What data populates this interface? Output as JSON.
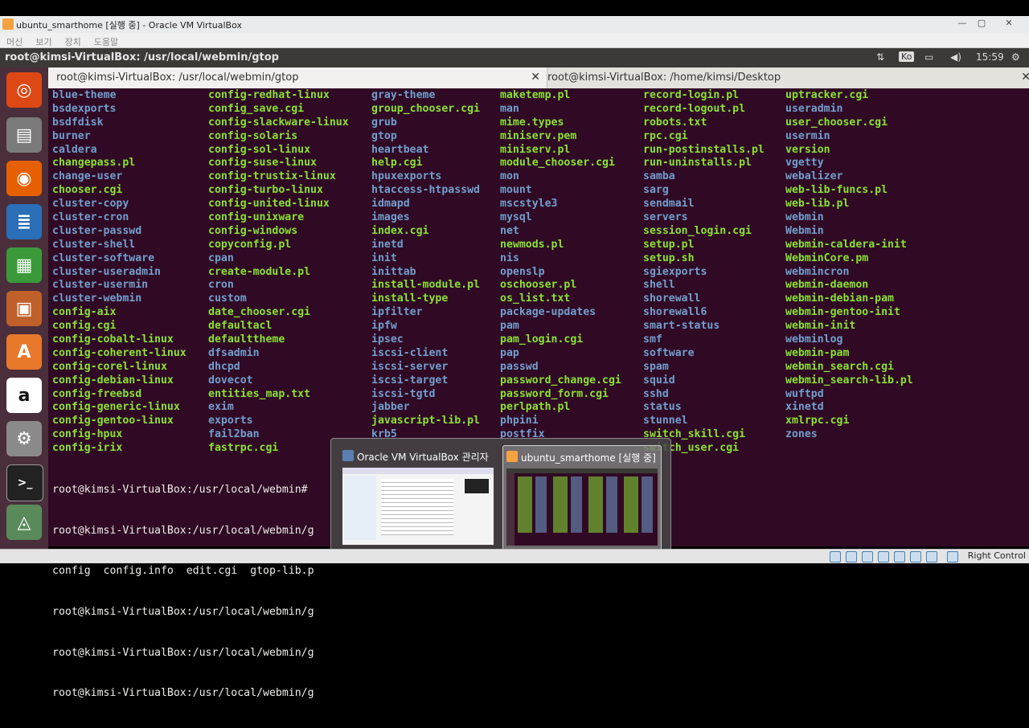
{
  "vbox": {
    "title": "ubuntu_smarthome [실행 중] - Oracle VM VirtualBox",
    "menu": [
      "머신",
      "보기",
      "장치",
      "도움말"
    ],
    "host_key": "Right Control"
  },
  "ubuntu_panel": {
    "title": "root@kimsi-VirtualBox: /usr/local/webmin/gtop",
    "keyboard": "Ko",
    "time": "15:59"
  },
  "terminal": {
    "tabs": [
      {
        "label": "root@kimsi-VirtualBox: /usr/local/webmin/gtop"
      },
      {
        "label": "root@kimsi-VirtualBox: /home/kimsi/Desktop"
      }
    ],
    "columns": [
      {
        "items": [
          {
            "t": "blue-theme",
            "c": "b"
          },
          {
            "t": "bsdexports",
            "c": "b"
          },
          {
            "t": "bsdfdisk",
            "c": "b"
          },
          {
            "t": "burner",
            "c": "b"
          },
          {
            "t": "caldera",
            "c": "b"
          },
          {
            "t": "changepass.pl",
            "c": "w"
          },
          {
            "t": "change-user",
            "c": "b"
          },
          {
            "t": "chooser.cgi",
            "c": "w"
          },
          {
            "t": "cluster-copy",
            "c": "b"
          },
          {
            "t": "cluster-cron",
            "c": "b"
          },
          {
            "t": "cluster-passwd",
            "c": "b"
          },
          {
            "t": "cluster-shell",
            "c": "b"
          },
          {
            "t": "cluster-software",
            "c": "b"
          },
          {
            "t": "cluster-useradmin",
            "c": "b"
          },
          {
            "t": "cluster-usermin",
            "c": "b"
          },
          {
            "t": "cluster-webmin",
            "c": "b"
          },
          {
            "t": "config-aix",
            "c": "w"
          },
          {
            "t": "config.cgi",
            "c": "w"
          },
          {
            "t": "config-cobalt-linux",
            "c": "w"
          },
          {
            "t": "config-coherent-linux",
            "c": "w"
          },
          {
            "t": "config-corel-linux",
            "c": "w"
          },
          {
            "t": "config-debian-linux",
            "c": "w"
          },
          {
            "t": "config-freebsd",
            "c": "w"
          },
          {
            "t": "config-generic-linux",
            "c": "w"
          },
          {
            "t": "config-gentoo-linux",
            "c": "w"
          },
          {
            "t": "config-hpux",
            "c": "w"
          },
          {
            "t": "config-irix",
            "c": "w"
          }
        ]
      },
      {
        "items": [
          {
            "t": "config-redhat-linux",
            "c": "w"
          },
          {
            "t": "config_save.cgi",
            "c": "w"
          },
          {
            "t": "config-slackware-linux",
            "c": "w"
          },
          {
            "t": "config-solaris",
            "c": "w"
          },
          {
            "t": "config-sol-linux",
            "c": "w"
          },
          {
            "t": "config-suse-linux",
            "c": "w"
          },
          {
            "t": "config-trustix-linux",
            "c": "w"
          },
          {
            "t": "config-turbo-linux",
            "c": "w"
          },
          {
            "t": "config-united-linux",
            "c": "w"
          },
          {
            "t": "config-unixware",
            "c": "w"
          },
          {
            "t": "config-windows",
            "c": "w"
          },
          {
            "t": "copyconfig.pl",
            "c": "w"
          },
          {
            "t": "cpan",
            "c": "b"
          },
          {
            "t": "create-module.pl",
            "c": "w"
          },
          {
            "t": "cron",
            "c": "b"
          },
          {
            "t": "custom",
            "c": "b"
          },
          {
            "t": "date_chooser.cgi",
            "c": "w"
          },
          {
            "t": "defaultacl",
            "c": "w"
          },
          {
            "t": "defaulttheme",
            "c": "w"
          },
          {
            "t": "dfsadmin",
            "c": "b"
          },
          {
            "t": "dhcpd",
            "c": "b"
          },
          {
            "t": "dovecot",
            "c": "b"
          },
          {
            "t": "entities_map.txt",
            "c": "w"
          },
          {
            "t": "exim",
            "c": "b"
          },
          {
            "t": "exports",
            "c": "b"
          },
          {
            "t": "fail2ban",
            "c": "b"
          },
          {
            "t": "fastrpc.cgi",
            "c": "w"
          }
        ]
      },
      {
        "items": [
          {
            "t": "gray-theme",
            "c": "b"
          },
          {
            "t": "group_chooser.cgi",
            "c": "w"
          },
          {
            "t": "grub",
            "c": "b"
          },
          {
            "t": "gtop",
            "c": "b"
          },
          {
            "t": "heartbeat",
            "c": "b"
          },
          {
            "t": "help.cgi",
            "c": "w"
          },
          {
            "t": "hpuxexports",
            "c": "b"
          },
          {
            "t": "htaccess-htpasswd",
            "c": "b"
          },
          {
            "t": "idmapd",
            "c": "b"
          },
          {
            "t": "images",
            "c": "b"
          },
          {
            "t": "index.cgi",
            "c": "w"
          },
          {
            "t": "inetd",
            "c": "b"
          },
          {
            "t": "init",
            "c": "b"
          },
          {
            "t": "inittab",
            "c": "b"
          },
          {
            "t": "install-module.pl",
            "c": "w"
          },
          {
            "t": "install-type",
            "c": "w"
          },
          {
            "t": "ipfilter",
            "c": "b"
          },
          {
            "t": "ipfw",
            "c": "b"
          },
          {
            "t": "ipsec",
            "c": "b"
          },
          {
            "t": "iscsi-client",
            "c": "b"
          },
          {
            "t": "iscsi-server",
            "c": "b"
          },
          {
            "t": "iscsi-target",
            "c": "b"
          },
          {
            "t": "iscsi-tgtd",
            "c": "b"
          },
          {
            "t": "jabber",
            "c": "b"
          },
          {
            "t": "javascript-lib.pl",
            "c": "w"
          },
          {
            "t": "krb5",
            "c": "b"
          }
        ]
      },
      {
        "items": [
          {
            "t": "maketemp.pl",
            "c": "w"
          },
          {
            "t": "man",
            "c": "b"
          },
          {
            "t": "mime.types",
            "c": "w"
          },
          {
            "t": "miniserv.pem",
            "c": "w"
          },
          {
            "t": "miniserv.pl",
            "c": "w"
          },
          {
            "t": "module_chooser.cgi",
            "c": "w"
          },
          {
            "t": "mon",
            "c": "b"
          },
          {
            "t": "mount",
            "c": "b"
          },
          {
            "t": "mscstyle3",
            "c": "b"
          },
          {
            "t": "mysql",
            "c": "b"
          },
          {
            "t": "net",
            "c": "b"
          },
          {
            "t": "newmods.pl",
            "c": "w"
          },
          {
            "t": "nis",
            "c": "b"
          },
          {
            "t": "openslp",
            "c": "b"
          },
          {
            "t": "oschooser.pl",
            "c": "w"
          },
          {
            "t": "os_list.txt",
            "c": "w"
          },
          {
            "t": "package-updates",
            "c": "b"
          },
          {
            "t": "pam",
            "c": "b"
          },
          {
            "t": "pam_login.cgi",
            "c": "w"
          },
          {
            "t": "pap",
            "c": "b"
          },
          {
            "t": "passwd",
            "c": "b"
          },
          {
            "t": "password_change.cgi",
            "c": "w"
          },
          {
            "t": "password_form.cgi",
            "c": "w"
          },
          {
            "t": "perlpath.pl",
            "c": "w"
          },
          {
            "t": "phpini",
            "c": "b"
          },
          {
            "t": "postfix",
            "c": "b"
          }
        ]
      },
      {
        "items": [
          {
            "t": "record-login.pl",
            "c": "w"
          },
          {
            "t": "record-logout.pl",
            "c": "w"
          },
          {
            "t": "robots.txt",
            "c": "w"
          },
          {
            "t": "rpc.cgi",
            "c": "w"
          },
          {
            "t": "run-postinstalls.pl",
            "c": "w"
          },
          {
            "t": "run-uninstalls.pl",
            "c": "w"
          },
          {
            "t": "samba",
            "c": "b"
          },
          {
            "t": "sarg",
            "c": "b"
          },
          {
            "t": "sendmail",
            "c": "b"
          },
          {
            "t": "servers",
            "c": "b"
          },
          {
            "t": "session_login.cgi",
            "c": "w"
          },
          {
            "t": "setup.pl",
            "c": "w"
          },
          {
            "t": "setup.sh",
            "c": "w"
          },
          {
            "t": "sgiexports",
            "c": "b"
          },
          {
            "t": "shell",
            "c": "b"
          },
          {
            "t": "shorewall",
            "c": "b"
          },
          {
            "t": "shorewall6",
            "c": "b"
          },
          {
            "t": "smart-status",
            "c": "b"
          },
          {
            "t": "smf",
            "c": "b"
          },
          {
            "t": "software",
            "c": "b"
          },
          {
            "t": "spam",
            "c": "b"
          },
          {
            "t": "squid",
            "c": "b"
          },
          {
            "t": "sshd",
            "c": "b"
          },
          {
            "t": "status",
            "c": "b"
          },
          {
            "t": "stunnel",
            "c": "b"
          },
          {
            "t": "switch_skill.cgi",
            "c": "w"
          },
          {
            "t": "switch_user.cgi",
            "c": "w"
          }
        ]
      },
      {
        "items": [
          {
            "t": "uptracker.cgi",
            "c": "w"
          },
          {
            "t": "useradmin",
            "c": "b"
          },
          {
            "t": "user_chooser.cgi",
            "c": "w"
          },
          {
            "t": "usermin",
            "c": "b"
          },
          {
            "t": "version",
            "c": "w"
          },
          {
            "t": "vgetty",
            "c": "b"
          },
          {
            "t": "webalizer",
            "c": "b"
          },
          {
            "t": "web-lib-funcs.pl",
            "c": "w"
          },
          {
            "t": "web-lib.pl",
            "c": "w"
          },
          {
            "t": "webmin",
            "c": "b"
          },
          {
            "t": "Webmin",
            "c": "b"
          },
          {
            "t": "webmin-caldera-init",
            "c": "w"
          },
          {
            "t": "WebminCore.pm",
            "c": "w"
          },
          {
            "t": "webmincron",
            "c": "b"
          },
          {
            "t": "webmin-daemon",
            "c": "w"
          },
          {
            "t": "webmin-debian-pam",
            "c": "w"
          },
          {
            "t": "webmin-gentoo-init",
            "c": "w"
          },
          {
            "t": "webmin-init",
            "c": "w"
          },
          {
            "t": "webminlog",
            "c": "b"
          },
          {
            "t": "webmin-pam",
            "c": "w"
          },
          {
            "t": "webmin_search.cgi",
            "c": "w"
          },
          {
            "t": "webmin_search-lib.pl",
            "c": "w"
          },
          {
            "t": "wuftpd",
            "c": "b"
          },
          {
            "t": "xinetd",
            "c": "b"
          },
          {
            "t": "xmlrpc.cgi",
            "c": "w"
          },
          {
            "t": "zones",
            "c": "b"
          }
        ]
      }
    ],
    "prompts": [
      "root@kimsi-VirtualBox:/usr/local/webmin#",
      "root@kimsi-VirtualBox:/usr/local/webmin/g",
      "config  config.info  edit.cgi  gtop-lib.p",
      "root@kimsi-VirtualBox:/usr/local/webmin/g",
      "root@kimsi-VirtualBox:/usr/local/webmin/g",
      "root@kimsi-VirtualBox:/usr/local/webmin/g"
    ]
  },
  "switcher": {
    "items": [
      {
        "label": "Oracle VM VirtualBox 관리자"
      },
      {
        "label": "ubuntu_smarthome [실행 중] -..."
      }
    ]
  },
  "colors": {
    "exec": "#8ae234",
    "dir": "#729fcf",
    "bg": "#300a24"
  }
}
